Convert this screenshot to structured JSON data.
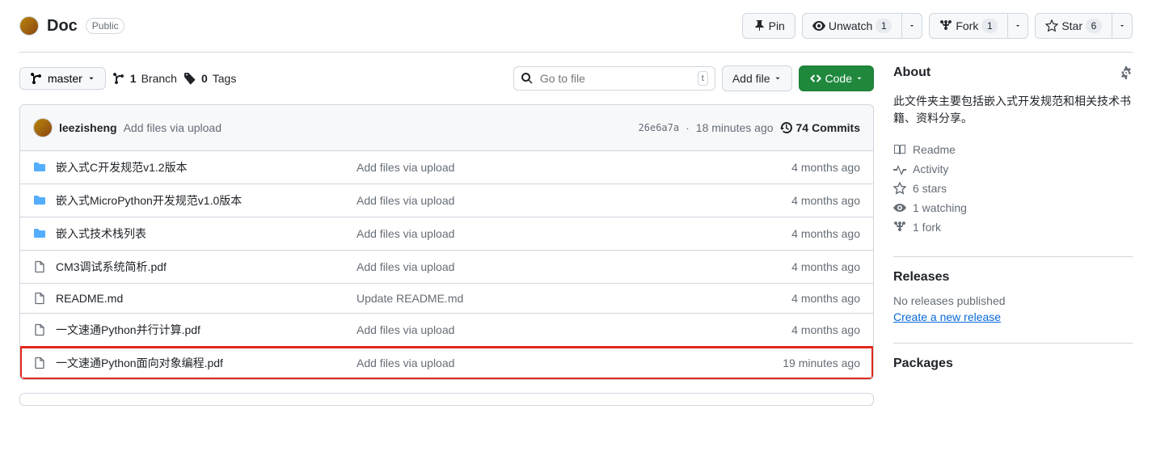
{
  "header": {
    "repo_name": "Doc",
    "visibility": "Public",
    "pin_label": "Pin",
    "unwatch_label": "Unwatch",
    "unwatch_count": "1",
    "fork_label": "Fork",
    "fork_count": "1",
    "star_label": "Star",
    "star_count": "6"
  },
  "toolbar": {
    "branch": "master",
    "branches_count": "1",
    "branches_label": "Branch",
    "tags_count": "0",
    "tags_label": "Tags",
    "search_placeholder": "Go to file",
    "search_kbd": "t",
    "add_file_label": "Add file",
    "code_label": "Code"
  },
  "commit_summary": {
    "author": "leezisheng",
    "message": "Add files via upload",
    "hash": "26e6a7a",
    "age": "18 minutes ago",
    "commits_count": "74",
    "commits_label": "Commits"
  },
  "files": [
    {
      "type": "folder",
      "name": "嵌入式C开发规范v1.2版本",
      "msg": "Add files via upload",
      "age": "4 months ago",
      "hl": false
    },
    {
      "type": "folder",
      "name": "嵌入式MicroPython开发规范v1.0版本",
      "msg": "Add files via upload",
      "age": "4 months ago",
      "hl": false
    },
    {
      "type": "folder",
      "name": "嵌入式技术栈列表",
      "msg": "Add files via upload",
      "age": "4 months ago",
      "hl": false
    },
    {
      "type": "file",
      "name": "CM3调试系统简析.pdf",
      "msg": "Add files via upload",
      "age": "4 months ago",
      "hl": false
    },
    {
      "type": "file",
      "name": "README.md",
      "msg": "Update README.md",
      "age": "4 months ago",
      "hl": false
    },
    {
      "type": "file",
      "name": "一文速通Python并行计算.pdf",
      "msg": "Add files via upload",
      "age": "4 months ago",
      "hl": false
    },
    {
      "type": "file",
      "name": "一文速通Python面向对象编程.pdf",
      "msg": "Add files via upload",
      "age": "19 minutes ago",
      "hl": true
    }
  ],
  "about": {
    "title": "About",
    "description": "此文件夹主要包括嵌入式开发规范和相关技术书籍、资料分享。",
    "links": {
      "readme": "Readme",
      "activity": "Activity",
      "stars": "6 stars",
      "watching": "1 watching",
      "forks": "1 fork"
    }
  },
  "releases": {
    "title": "Releases",
    "empty": "No releases published",
    "create": "Create a new release"
  },
  "packages": {
    "title": "Packages"
  }
}
